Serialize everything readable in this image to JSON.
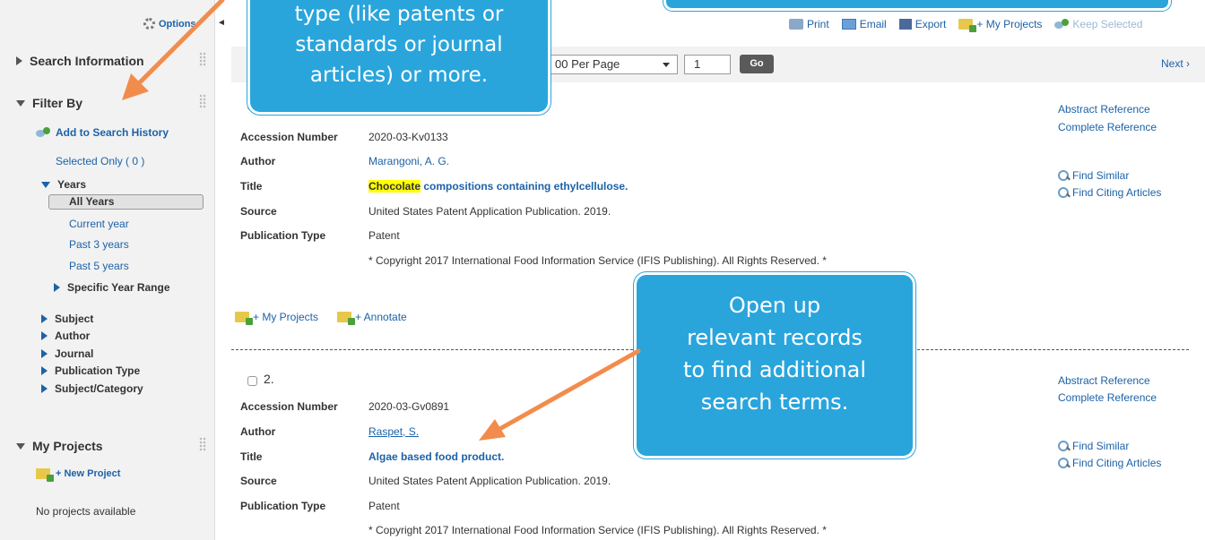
{
  "sidebar": {
    "options_label": "Options",
    "search_information": "Search Information",
    "filter_by": "Filter By",
    "add_to_history": "Add to Search History",
    "selected_only": "Selected Only ( 0 )",
    "years_label": "Years",
    "years_options": [
      "All Years",
      "Current year",
      "Past 3 years",
      "Past 5 years"
    ],
    "specific_year_range": "Specific Year Range",
    "facets": [
      "Subject",
      "Author",
      "Journal",
      "Publication Type",
      "Subject/Category"
    ],
    "my_projects": "My Projects",
    "new_project": "+ New Project",
    "no_projects": "No projects available"
  },
  "topbar": {
    "print": "Print",
    "email": "Email",
    "export": "Export",
    "my_projects": "+ My Projects",
    "keep_selected": "Keep Selected"
  },
  "toolbar": {
    "per_page": "00 Per Page",
    "page": "1",
    "go": "Go",
    "next": "Next ›"
  },
  "labels": {
    "accession": "Accession Number",
    "author": "Author",
    "title": "Title",
    "source": "Source",
    "pub_type": "Publication Type",
    "abstract": "Abstract Reference",
    "complete": "Complete Reference",
    "find_similar": "Find Similar",
    "find_citing": "Find Citing Articles",
    "plus_projects": "+ My Projects",
    "plus_annotate": "+ Annotate"
  },
  "records": [
    {
      "accession": "2020-03-Kv0133",
      "author": "Marangoni, A. G.",
      "title_highlight": "Chocolate",
      "title_rest": " compositions containing ethylcellulose.",
      "source": "United States Patent Application Publication. 2019.",
      "pub_type": "Patent",
      "copyright": "* Copyright 2017 International Food Information Service (IFIS Publishing). All Rights Reserved. *"
    },
    {
      "number": "2.",
      "accession": "2020-03-Gv0891",
      "author": "Raspet, S.",
      "title": "Algae based food product.",
      "source": "United States Patent Application Publication. 2019.",
      "pub_type": "Patent",
      "copyright": "* Copyright 2017 International Food Information Service (IFIS Publishing). All Rights Reserved. *"
    }
  ],
  "callouts": {
    "top_left_lines": [
      "type (like patents or",
      "standards or journal",
      "articles) or more."
    ],
    "bottom_lines": [
      "Open up",
      "relevant records",
      "to find additional",
      "search terms."
    ]
  },
  "colors": {
    "callout": "#29a5dc",
    "arrow": "#f28c4c",
    "link": "#1c62a8"
  }
}
